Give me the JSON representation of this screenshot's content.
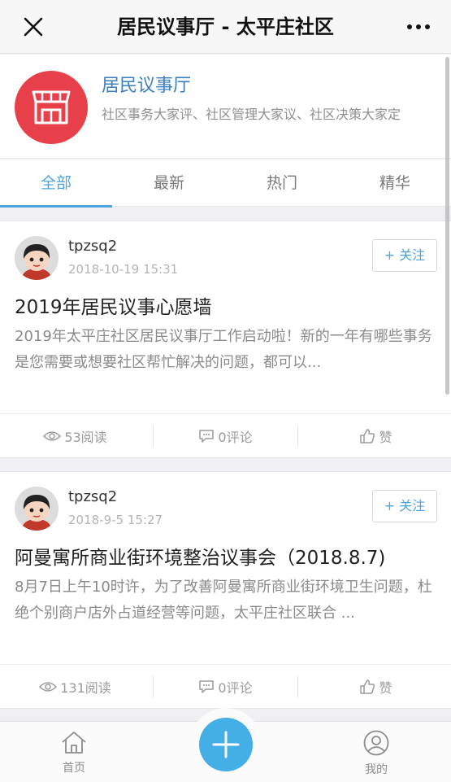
{
  "topbar": {
    "title": "居民议事厅 - 太平庄社区"
  },
  "header": {
    "name": "居民议事厅",
    "description": "社区事务大家评、社区管理大家议、社区决策大家定"
  },
  "tabs": [
    {
      "label": "全部",
      "active": true
    },
    {
      "label": "最新"
    },
    {
      "label": "热门"
    },
    {
      "label": "精华"
    }
  ],
  "posts": [
    {
      "user": "tpzsq2",
      "date": "2018-10-19 15:31",
      "follow": "+ 关注",
      "title": "2019年居民议事心愿墙",
      "excerpt": "2019年太平庄社区居民议事厅工作启动啦！新的一年有哪些事务是您需要或想要社区帮忙解决的问题，都可以...",
      "reads": "53阅读",
      "comments": "0评论",
      "like": "赞"
    },
    {
      "user": "tpzsq2",
      "date": "2018-9-5 15:27",
      "follow": "+ 关注",
      "title": "阿曼寓所商业街环境整治议事会（2018.8.7)",
      "excerpt": "8月7日上午10时许，为了改善阿曼寓所商业街环境卫生问题，杜绝个别商户店外占道经营等问题，太平庄社区联合 ...",
      "reads": "131阅读",
      "comments": "0评论",
      "like": "赞"
    }
  ],
  "bottom_nav": {
    "home": "首页",
    "mine": "我的"
  },
  "colors": {
    "accent": "#4ba4de",
    "logo": "#e8404a",
    "fab": "#44aee6"
  },
  "icons": [
    "close-icon",
    "more-icon",
    "storefront-icon",
    "eye-icon",
    "comment-icon",
    "thumbs-up-icon",
    "home-icon",
    "user-icon",
    "plus-icon"
  ]
}
